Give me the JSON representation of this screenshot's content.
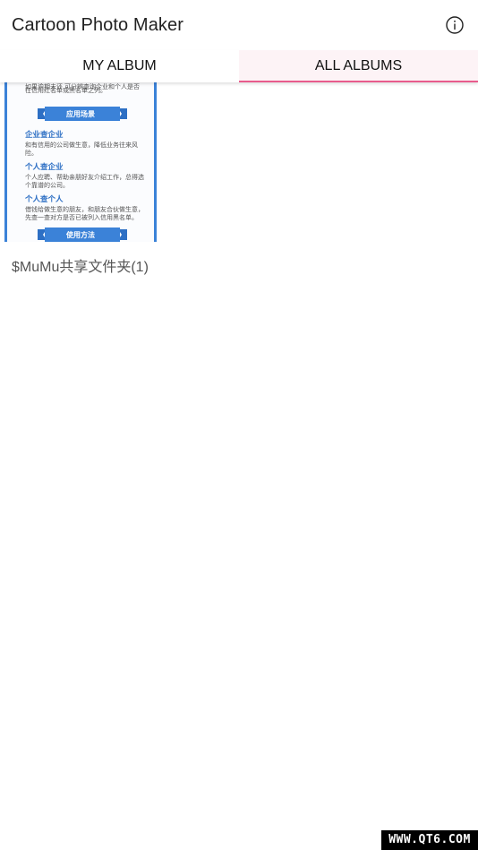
{
  "app": {
    "title": "Cartoon Photo Maker"
  },
  "tabs": [
    {
      "label": "MY ALBUM",
      "selected": false
    },
    {
      "label": "ALL ALBUMS",
      "selected": true
    }
  ],
  "accent_color": "#e85b8c",
  "albums": [
    {
      "label": "$MuMu共享文件夹(1)",
      "thumbnail": {
        "lines_top": [
          "如果逾期未还,可分辨查询企业和个人是否",
          "在信用红名单或黑名单之列。"
        ],
        "ribbon1": "应用场景",
        "h1": "企业查企业",
        "t1": [
          "和有信用的公司做生意，降低业务往来风",
          "险。"
        ],
        "h2": "个人查企业",
        "t2": [
          "个人应聘、帮助亲朋好友介绍工作，总得选",
          "个靠谱的公司。"
        ],
        "h3": "个人查个人",
        "t3": [
          "借钱给做生意的朋友，和朋友合伙做生意，",
          "先查一查对方是否已被列入信用黑名单。"
        ],
        "ribbon2": "使用方法"
      }
    }
  ],
  "watermark": "WWW.QT6.COM"
}
